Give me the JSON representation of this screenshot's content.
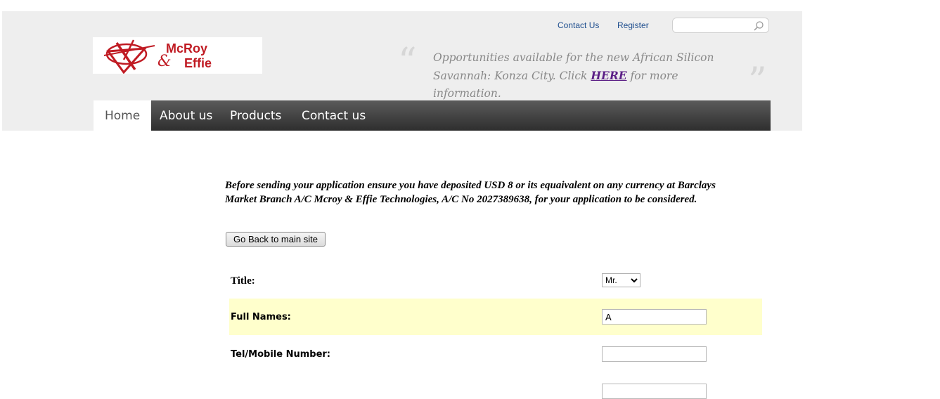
{
  "header": {
    "links": [
      "Contact Us",
      "Register"
    ],
    "search": {
      "value": "",
      "placeholder": ""
    },
    "logo": {
      "line1": "McRoy",
      "line2": "Effie",
      "amp": "&"
    },
    "promo": {
      "text_before": "Opportunities available for the new African Silicon Savannah: Konza City. Click ",
      "link": "HERE",
      "text_after": " for more information."
    }
  },
  "nav": {
    "items": [
      "Home",
      "About us",
      "Products",
      "Contact us"
    ],
    "active": "Home"
  },
  "main": {
    "notice": "Before sending your application ensure you have deposited USD 8 or its equaivalent on any currency at Barclays Market Branch A/C Mcroy & Effie Technologies, A/C No 2027389638, for your application to be considered.",
    "back_button": "Go Back to main site",
    "form": {
      "title_label": "Title:",
      "title_value": "Mr.",
      "fullnames_label": "Full Names:",
      "fullnames_value": "A",
      "tel_label": "Tel/Mobile Number:",
      "tel_value": ""
    }
  },
  "colors": {
    "brand_red": "#c01b23",
    "nav_dark": "#3a3a3a",
    "highlight_row": "#ffffcc",
    "link_purple": "#5b1e86"
  }
}
